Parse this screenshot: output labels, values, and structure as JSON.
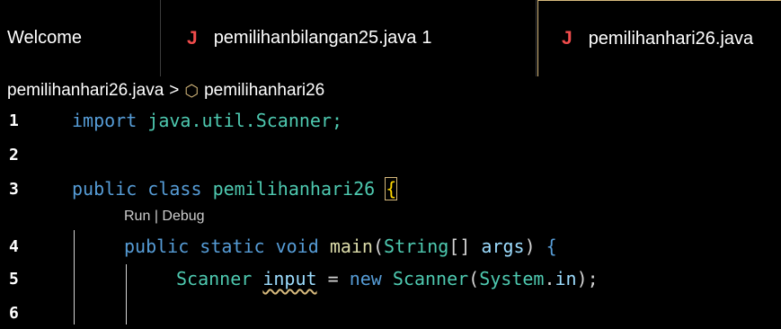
{
  "tabs": [
    {
      "label": "Welcome"
    },
    {
      "icon": "J",
      "label": "pemilihanbilangan25.java",
      "problems": "1"
    },
    {
      "icon": "J",
      "label": "pemilihanhari26.java"
    }
  ],
  "breadcrumb": {
    "file": "pemilihanhari26.java",
    "separator": ">",
    "symbol": "pemilihanhari26"
  },
  "code_lens": {
    "run": "Run",
    "divider": "|",
    "debug": "Debug"
  },
  "lines": {
    "1": {
      "number": "1",
      "t1": "import",
      "t2": " java.util.Scanner;"
    },
    "2": {
      "number": "2"
    },
    "3": {
      "number": "3",
      "t1": "public",
      "t2": " ",
      "t3": "class",
      "t4": " ",
      "t5": "pemilihanhari26",
      "t6": " ",
      "t7": "{"
    },
    "4": {
      "number": "4",
      "t1": "public",
      "t2": " ",
      "t3": "static",
      "t4": " ",
      "t5": "void",
      "t6": " ",
      "t7": "main",
      "t8": "(",
      "t9": "String",
      "t10": "[] ",
      "t11": "args",
      "t12": ") ",
      "t13": "{"
    },
    "5": {
      "number": "5",
      "t1": "Scanner",
      "t2": " ",
      "t3": "input",
      "t4": " = ",
      "t5": "new",
      "t6": " ",
      "t7": "Scanner",
      "t8": "(",
      "t9": "System",
      "t10": ".",
      "t11": "in",
      "t12": ");"
    },
    "6": {
      "number": "6"
    }
  }
}
